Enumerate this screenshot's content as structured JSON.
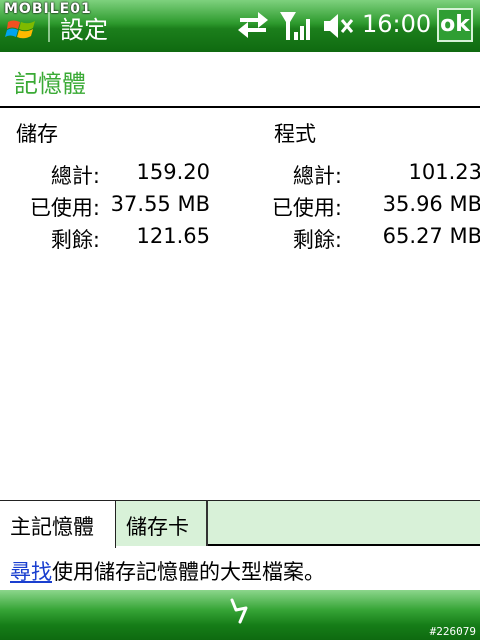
{
  "watermark": "MOBILE01",
  "titlebar": {
    "app_title": "設定",
    "clock": "16:00",
    "ok_label": "ok",
    "icons": [
      "windows-start-icon",
      "sync-arrows-icon",
      "signal-strength-icon",
      "volume-muted-icon"
    ]
  },
  "page": {
    "title": "記憶體"
  },
  "storage": {
    "heading": "儲存",
    "rows": [
      {
        "label": "總計:",
        "value": "159.20"
      },
      {
        "label": "已使用:",
        "value": "37.55 MB"
      },
      {
        "label": "剩餘:",
        "value": "121.65"
      }
    ]
  },
  "program": {
    "heading": "程式",
    "rows": [
      {
        "label": "總計:",
        "value": "101.23"
      },
      {
        "label": "已使用:",
        "value": "35.96 MB"
      },
      {
        "label": "剩餘:",
        "value": "65.27 MB"
      }
    ]
  },
  "tabs": [
    {
      "label": "主記憶體",
      "active": true
    },
    {
      "label": "儲存卡",
      "active": false
    }
  ],
  "hint": {
    "link": "尋找",
    "text": "使用儲存記憶體的大型檔案。"
  },
  "credit": "#226079",
  "colors": {
    "title_green": "#3aaa35",
    "bar_green": "#1c7f1c",
    "tab_bg": "#d8f1d8",
    "link_blue": "#1a3fcf"
  }
}
